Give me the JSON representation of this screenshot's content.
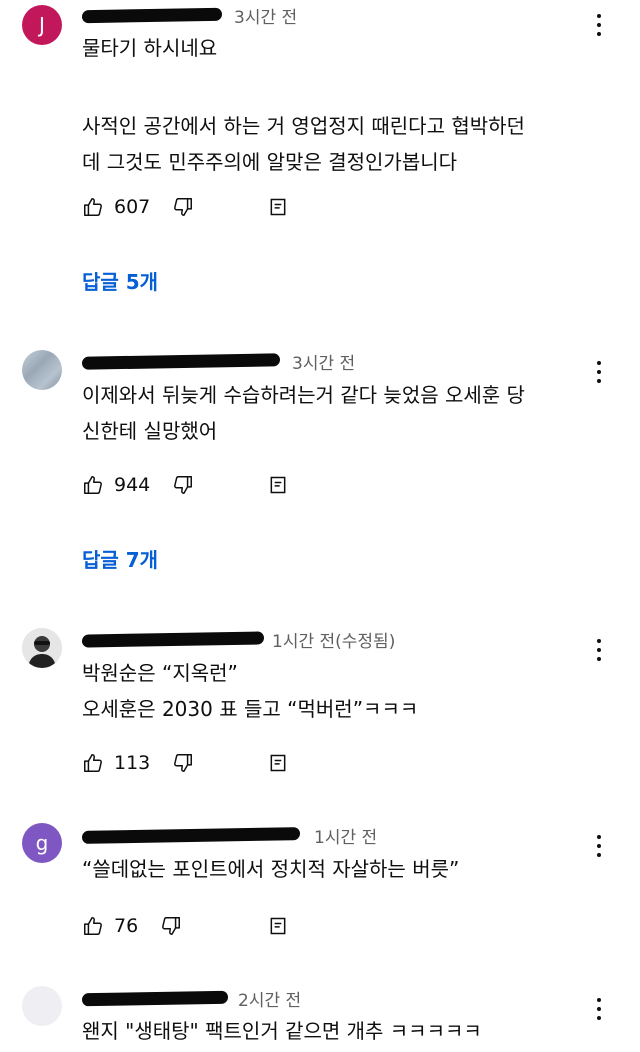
{
  "icons": {
    "like": "thumbs-up-icon",
    "dislike": "thumbs-down-icon",
    "reply": "reply-icon",
    "more": "more-vertical-icon"
  },
  "colors": {
    "link": "#065fd4",
    "meta": "#606060",
    "avatar_j": "#c2185b",
    "avatar_g": "#7e57c2",
    "avatar_blank": "#eeeef3"
  },
  "comments": [
    {
      "avatar_letter": "J",
      "time": "3시간 전",
      "lines": [
        "물타기 하시네요",
        "",
        "사적인 공간에서 하는 거 영업정지 때린다고 협박하던",
        "데 그것도 민주주의에 알맞은 결정인가봅니다"
      ],
      "likes": "607",
      "replies": "답글 5개"
    },
    {
      "avatar_letter": "",
      "time": "3시간 전",
      "lines": [
        "이제와서 뒤늦게 수습하려는거 같다 늦었음 오세훈 당",
        "신한테 실망했어"
      ],
      "likes": "944",
      "replies": "답글 7개"
    },
    {
      "avatar_letter": "",
      "time": "1시간 전(수정됨)",
      "lines": [
        "박원순은 “지옥런”",
        "오세훈은 2030 표 들고 “먹버런”ㅋㅋㅋ"
      ],
      "likes": "113"
    },
    {
      "avatar_letter": "g",
      "time": "1시간 전",
      "lines": [
        "“쓸데없는 포인트에서 정치적 자살하는 버릇”"
      ],
      "likes": "76"
    },
    {
      "avatar_letter": "",
      "time": "2시간 전",
      "lines": [
        "왠지 \"생태탕\" 팩트인거 같으면 개추 ㅋㅋㅋㅋㅋ"
      ]
    }
  ]
}
